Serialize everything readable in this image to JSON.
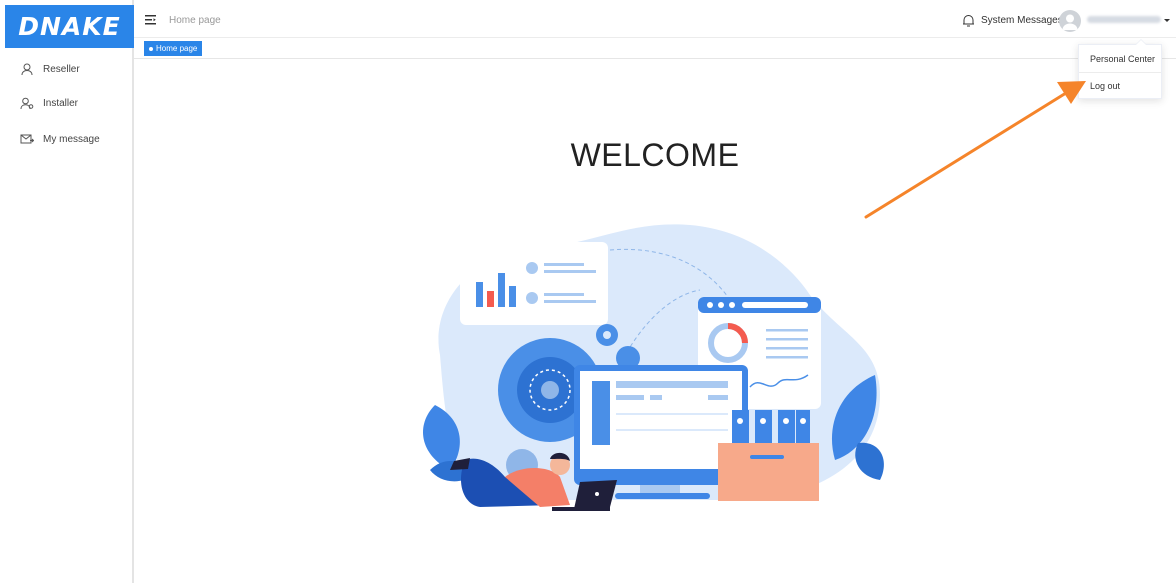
{
  "app": {
    "logo_text": "DNAKE",
    "brand_color": "#2a85e8"
  },
  "sidebar": {
    "items": [
      {
        "label": "Reseller",
        "icon": "user-icon"
      },
      {
        "label": "Installer",
        "icon": "users-icon"
      },
      {
        "label": "My message",
        "icon": "envelope-icon"
      }
    ]
  },
  "header": {
    "breadcrumb": "Home page",
    "system_messages": "System Messages"
  },
  "tags": {
    "active": "Home page"
  },
  "user_menu": {
    "items": [
      "Personal Center",
      "Log out"
    ]
  },
  "main": {
    "welcome": "WELCOME"
  },
  "annotation": {
    "arrow_color": "#f5842a"
  }
}
